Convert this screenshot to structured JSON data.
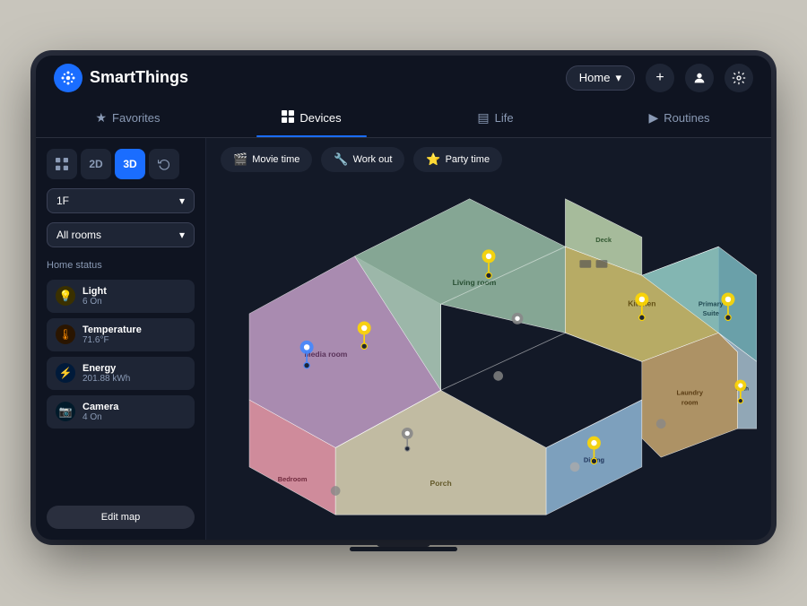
{
  "app": {
    "name": "SmartThings",
    "logo_symbol": "⚙"
  },
  "header": {
    "home_label": "Home",
    "add_btn": "+",
    "profile_icon": "person",
    "settings_icon": "gear"
  },
  "nav": {
    "tabs": [
      {
        "id": "favorites",
        "label": "Favorites",
        "icon": "★",
        "active": false
      },
      {
        "id": "devices",
        "label": "Devices",
        "icon": "⊞",
        "active": true
      },
      {
        "id": "life",
        "label": "Life",
        "icon": "▤",
        "active": false
      },
      {
        "id": "routines",
        "label": "Routines",
        "icon": "▶",
        "active": false
      }
    ]
  },
  "sidebar": {
    "view_buttons": [
      {
        "id": "grid",
        "label": "⊞",
        "active": false
      },
      {
        "id": "2d",
        "label": "2D",
        "active": false
      },
      {
        "id": "3d",
        "label": "3D",
        "active": true
      },
      {
        "id": "history",
        "label": "↺",
        "active": false
      }
    ],
    "floor_select": {
      "value": "1F",
      "chevron": "▾"
    },
    "room_select": {
      "value": "All rooms",
      "chevron": "▾"
    },
    "home_status_label": "Home status",
    "status_items": [
      {
        "id": "light",
        "icon": "💡",
        "type": "light",
        "name": "Light",
        "value": "6 On"
      },
      {
        "id": "temperature",
        "icon": "🌡",
        "type": "temp",
        "name": "Temperature",
        "value": "71.6°F"
      },
      {
        "id": "energy",
        "icon": "⚡",
        "type": "energy",
        "name": "Energy",
        "value": "201.88 kWh"
      },
      {
        "id": "camera",
        "icon": "📷",
        "type": "camera",
        "name": "Camera",
        "value": "4 On"
      }
    ],
    "edit_map_label": "Edit map"
  },
  "scenes": [
    {
      "id": "movie",
      "icon": "🎬",
      "label": "Movie time"
    },
    {
      "id": "workout",
      "icon": "🔧",
      "label": "Work out"
    },
    {
      "id": "party",
      "icon": "⭐",
      "label": "Party time"
    }
  ],
  "floor_plan": {
    "rooms": [
      {
        "name": "Media room",
        "color": "#c4a0c8"
      },
      {
        "name": "Living room",
        "color": "#a0c8b0"
      },
      {
        "name": "Kitchen",
        "color": "#d4c88c"
      },
      {
        "name": "Primary Suite",
        "color": "#88c4cc"
      },
      {
        "name": "Bedroom",
        "color": "#f0a0b0"
      },
      {
        "name": "Porch",
        "color": "#e8e8d0"
      },
      {
        "name": "Dining",
        "color": "#b0cce0"
      },
      {
        "name": "Laundry room",
        "color": "#d4c0a0"
      },
      {
        "name": "Bathroom",
        "color": "#c0d0e0"
      },
      {
        "name": "Deck",
        "color": "#d0e8d0"
      }
    ]
  }
}
